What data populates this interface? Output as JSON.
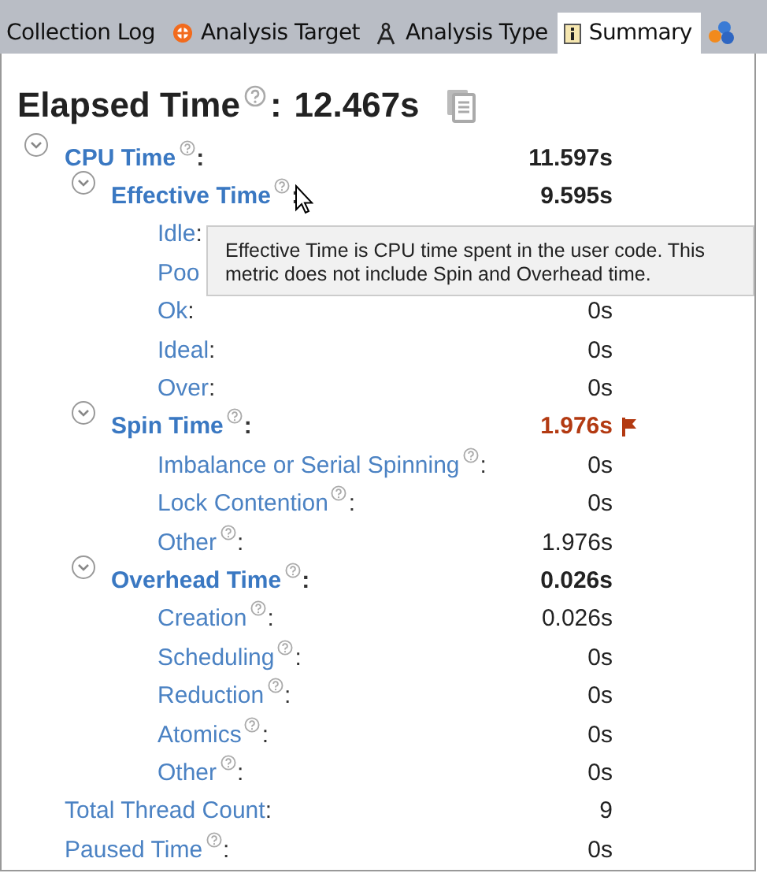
{
  "tabs": [
    {
      "label": "Collection Log",
      "selected": false
    },
    {
      "label": "Analysis Target",
      "selected": false
    },
    {
      "label": "Analysis Type",
      "selected": false
    },
    {
      "label": "Summary",
      "selected": true
    },
    {
      "selected": false
    }
  ],
  "separator": ":",
  "elapsed": {
    "label": "Elapsed Time",
    "value": "12.467s"
  },
  "metrics": [
    {
      "label": "CPU Time",
      "help": true,
      "value": "11.597s",
      "bold": true,
      "expanded": true,
      "children": [
        {
          "label": "Effective Time",
          "help": true,
          "value": "9.595s",
          "bold": true,
          "expanded": true,
          "children": [
            {
              "label": "Idle",
              "help": false,
              "bold": false
            },
            {
              "label": "Poo",
              "help": false,
              "bold": false,
              "cut": true
            },
            {
              "label": "Ok",
              "help": false,
              "value": "0s",
              "bold": false
            },
            {
              "label": "Ideal",
              "help": false,
              "value": "0s",
              "bold": false
            },
            {
              "label": "Over",
              "help": false,
              "value": "0s",
              "bold": false
            }
          ]
        },
        {
          "label": "Spin Time",
          "help": true,
          "value": "1.976s",
          "bold": true,
          "flagged": true,
          "expanded": true,
          "children": [
            {
              "label": "Imbalance or Serial Spinning",
              "help": true,
              "value": "0s",
              "bold": false
            },
            {
              "label": "Lock Contention",
              "help": true,
              "value": "0s",
              "bold": false
            },
            {
              "label": "Other",
              "help": true,
              "value": "1.976s",
              "bold": false
            }
          ]
        },
        {
          "label": "Overhead Time",
          "help": true,
          "value": "0.026s",
          "bold": true,
          "expanded": true,
          "children": [
            {
              "label": "Creation",
              "help": true,
              "value": "0.026s",
              "bold": false
            },
            {
              "label": "Scheduling",
              "help": true,
              "value": "0s",
              "bold": false
            },
            {
              "label": "Reduction",
              "help": true,
              "value": "0s",
              "bold": false
            },
            {
              "label": "Atomics",
              "help": true,
              "value": "0s",
              "bold": false
            },
            {
              "label": "Other",
              "help": true,
              "value": "0s",
              "bold": false
            }
          ]
        }
      ]
    },
    {
      "label": "Total Thread Count",
      "help": false,
      "value": "9",
      "bold": false
    },
    {
      "label": "Paused Time",
      "help": true,
      "value": "0s",
      "bold": false
    }
  ],
  "tooltip": {
    "text": "Effective Time is CPU time spent in the user code. This metric does not include Spin and Overhead time."
  }
}
